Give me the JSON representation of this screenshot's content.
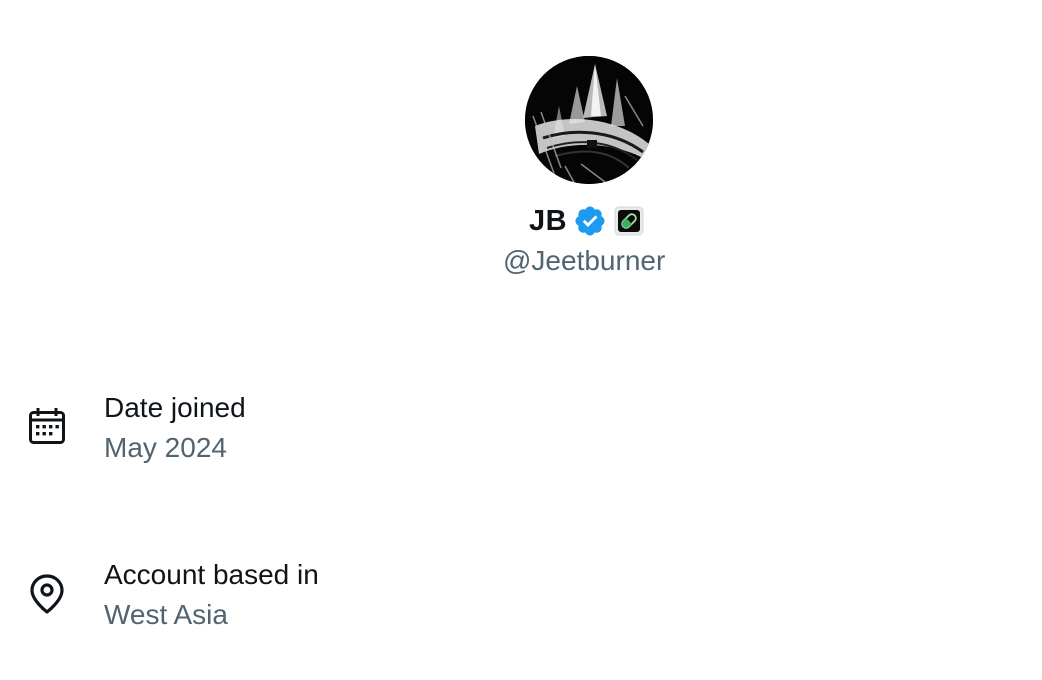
{
  "profile": {
    "display_name": "JB",
    "handle": "@Jeetburner",
    "avatar_icon": "profile-photo-dark-sketch",
    "verified_icon": "verified-badge-icon",
    "verified_color": "#1d9bf0",
    "affiliate_icon": "green-pill-badge-icon"
  },
  "about": {
    "date_joined": {
      "icon": "calendar-icon",
      "label": "Date joined",
      "value": "May 2024"
    },
    "location": {
      "icon": "location-pin-icon",
      "label": "Account based in",
      "value": "West Asia"
    }
  },
  "colors": {
    "primary_text": "#0f1419",
    "secondary_text": "#536471",
    "background": "#ffffff"
  }
}
